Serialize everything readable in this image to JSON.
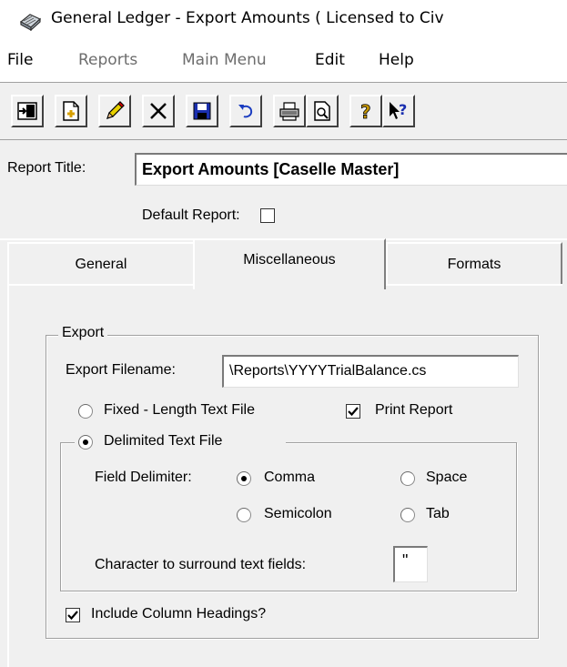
{
  "window": {
    "title": "General Ledger - Export Amounts    ( Licensed to Civ",
    "icon": "ledger-app-icon"
  },
  "menu": {
    "items": [
      {
        "label": "File",
        "enabled": true
      },
      {
        "label": "Reports",
        "enabled": false
      },
      {
        "label": "Main Menu",
        "enabled": false
      },
      {
        "label": "Edit",
        "enabled": true
      },
      {
        "label": "Help",
        "enabled": true
      }
    ]
  },
  "toolbar": {
    "buttons": [
      "exit-icon",
      "new-icon",
      "edit-icon",
      "delete-icon",
      "save-icon",
      "undo-icon",
      "print-icon",
      "print-preview-icon",
      "help-icon",
      "context-help-icon"
    ]
  },
  "report": {
    "title_label": "Report Title:",
    "title_value": "Export Amounts [Caselle Master]",
    "default_label": "Default Report:",
    "default_checked": false
  },
  "tabs": [
    {
      "label": "General",
      "active": false
    },
    {
      "label": "Miscellaneous",
      "active": true
    },
    {
      "label": "Formats",
      "active": false
    }
  ],
  "export": {
    "group_title": "Export",
    "filename_label": "Export Filename:",
    "filename_value": "\\Reports\\YYYYTrialBalance.cs",
    "fixed_length_label": "Fixed - Length Text File",
    "fixed_length_selected": false,
    "print_report_label": "Print Report",
    "print_report_checked": true,
    "delimited_label": "Delimited Text File",
    "delimited_selected": true,
    "field_delimiter_label": "Field Delimiter:",
    "delimiters": {
      "comma": {
        "label": "Comma",
        "selected": true
      },
      "space": {
        "label": "Space",
        "selected": false
      },
      "semicolon": {
        "label": "Semicolon",
        "selected": false
      },
      "tab": {
        "label": "Tab",
        "selected": false
      }
    },
    "surround_label": "Character to surround text fields:",
    "surround_value": "\"",
    "include_headings_label": "Include Column Headings?",
    "include_headings_checked": true
  }
}
